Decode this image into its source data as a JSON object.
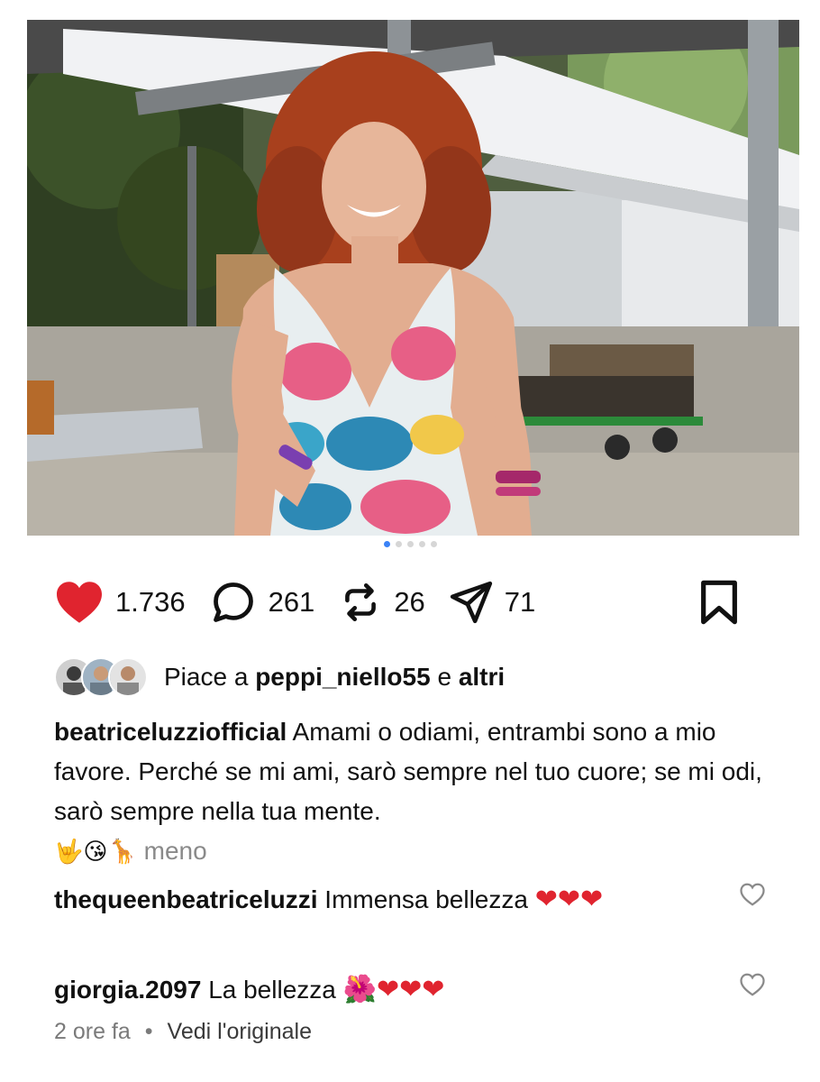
{
  "post": {
    "stats": {
      "likes": "1.736",
      "comments": "261",
      "reposts": "26",
      "shares": "71"
    },
    "liked_by": {
      "prefix": "Piace a",
      "user": "peppi_niello55",
      "conj": "e",
      "others": "altri"
    },
    "caption": {
      "username": "beatriceluzziofficial",
      "text": "Amami o odiami, entrambi sono a mio favore. Perché se mi ami, sarò sempre nel tuo cuore; se mi odi, sarò sempre nella tua mente.",
      "emojis": "🤟😘🦒",
      "less_label": "meno"
    },
    "comments": [
      {
        "username": "thequeenbeatriceluzzi",
        "text": "Immensa bellezza",
        "emojis": "❤❤❤"
      },
      {
        "username": "giorgia.2097",
        "text": "La bellezza",
        "emojis": "🌺❤❤❤"
      }
    ],
    "time_ago": "2 ore fa",
    "separator": "•",
    "see_original": "Vedi l'originale"
  },
  "colors": {
    "heart": "#e0242f",
    "active_dot": "#3b82f6",
    "muted_text": "#8a8a8a"
  },
  "icons": [
    "heart-filled-icon",
    "comment-bubble-icon",
    "repost-icon",
    "send-icon",
    "bookmark-icon",
    "heart-outline-icon"
  ]
}
